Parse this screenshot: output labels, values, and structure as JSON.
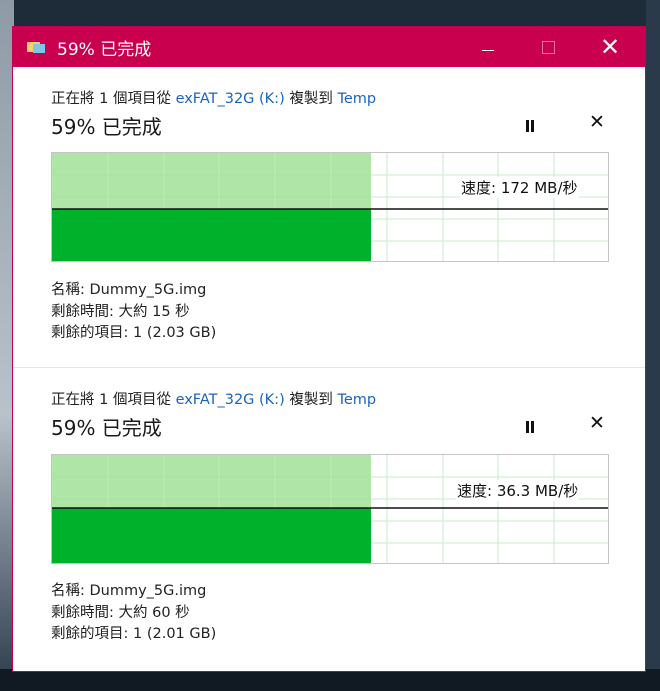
{
  "window": {
    "title": "59% 已完成",
    "colors": {
      "titlebar": "#c8004d",
      "progress_fill": "#00b12b",
      "progress_light": "#a6e29c",
      "grid": "#c8ebcc"
    }
  },
  "operations": [
    {
      "desc_prefix": "正在將 1 個項目從",
      "source": "exFAT_32G (K:)",
      "desc_mid": "複製到",
      "destination": "Temp",
      "percent_text": "59% 已完成",
      "progress": 0.59,
      "speed_text": "速度: 172 MB/秒",
      "speed_level": 0.5,
      "name_line": "名稱: Dummy_5G.img",
      "time_line": "剩餘時間: 大約 15 秒",
      "items_line": "剩餘的項目: 1 (2.03 GB)"
    },
    {
      "desc_prefix": "正在將 1 個項目從",
      "source": "exFAT_32G (K:)",
      "desc_mid": "複製到",
      "destination": "Temp",
      "percent_text": "59% 已完成",
      "progress": 0.59,
      "speed_text": "速度: 36.3 MB/秒",
      "speed_level": 0.53,
      "name_line": "名稱: Dummy_5G.img",
      "time_line": "剩餘時間: 大約 60 秒",
      "items_line": "剩餘的項目: 1 (2.01 GB)"
    }
  ]
}
